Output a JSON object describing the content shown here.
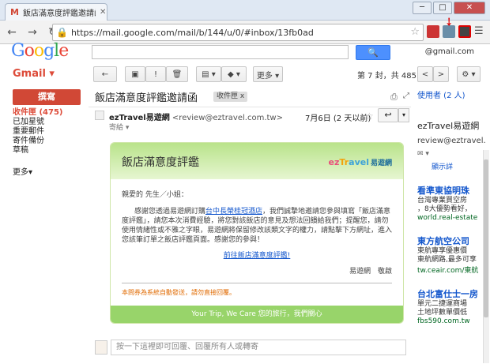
{
  "browser": {
    "tab_title": "飯店滿意度評鑑邀請函 - ",
    "tab_icon": "gmail-m-icon",
    "url": "https://mail.google.com/mail/b/144/u/0/#inbox/13fb0ad",
    "window_controls": [
      "─",
      "□",
      "✕"
    ]
  },
  "gmail": {
    "logo": "Google",
    "search_button": "🔍",
    "account": "@gmail.com",
    "product_label": "Gmail ▾",
    "toolbar": {
      "back": "←",
      "archive": "▣",
      "spam": "!",
      "delete": "🗑",
      "move": "▤ ▾",
      "labels": "◆ ▾",
      "more": "更多 ▾",
      "page_info": "第 7 封，共 485 封",
      "prev": "<",
      "next": ">",
      "settings": "⚙ ▾"
    },
    "compose": "撰寫",
    "nav": [
      "收件匣 (475)",
      "已加星號",
      "重要郵件",
      "寄件備份",
      "草稿"
    ],
    "more_nav": "更多▾"
  },
  "message": {
    "subject": "飯店滿意度評鑑邀請函",
    "label": "收件匣",
    "label_close": "x",
    "sender_name": "ezTravel易遊網",
    "sender_email": "<review@eztravel.com.tw>",
    "to": "寄給",
    "date": "7月6日 (2 天以前)",
    "reply": "↩",
    "reply_more": "▾"
  },
  "email_card": {
    "title": "飯店滿意度評鑑",
    "logo_e": "ez",
    "logo_z": "Tr",
    "logo_t": "avel",
    "logo_cn": "易遊網",
    "greeting": "親愛的 先生／小姐：",
    "para_1": "感謝您透過易遊網訂購",
    "para_link": "台中長榮桂冠酒店",
    "para_2": "，我們誠摯地邀請您參與填寫「飯店滿意度評鑑」，請您本次消費經驗，將您對該飯店的意見及想法回饋給我們；提醒您，請勿使用情緒性或不雅之字眼，易遊網將保留修改該類文字的權力，請點擊下方網址，進入您該筆訂單之飯店評鑑頁面。感謝您的參與！",
    "signature": "易遊網　敬啟",
    "survey_link": "前往飯店滿意度評鑑!",
    "notice": "本問券為系統自動發送，請勿直接回覆。",
    "footer": "Your Trip, We Care 您的旅行，我們關心"
  },
  "reply_box": {
    "placeholder": "按一下這裡即可回覆、回覆所有人或轉寄"
  },
  "sidebar": {
    "people": "使用者 (2 人)",
    "contact_name": "ezTravel易遊網",
    "contact_email": "review@eztravel.",
    "mail_icon": "✉ ▾",
    "show_more": "顯示詳",
    "ads": [
      {
        "title": "看準東協明珠",
        "desc1": "台灣專業買空房",
        "desc2": "，8大優勢看好，",
        "url": "world.real-estate"
      },
      {
        "title": "東方航空公司",
        "desc1": "東航專享優惠價",
        "desc2": "東航網路,最多可享",
        "url": "tw.ceair.com/東航"
      },
      {
        "title": "台北富仕士一房",
        "desc1": "單元二捷運商場",
        "desc2": "土地坪數單價低",
        "url": "fbs590.com.tw"
      }
    ]
  }
}
